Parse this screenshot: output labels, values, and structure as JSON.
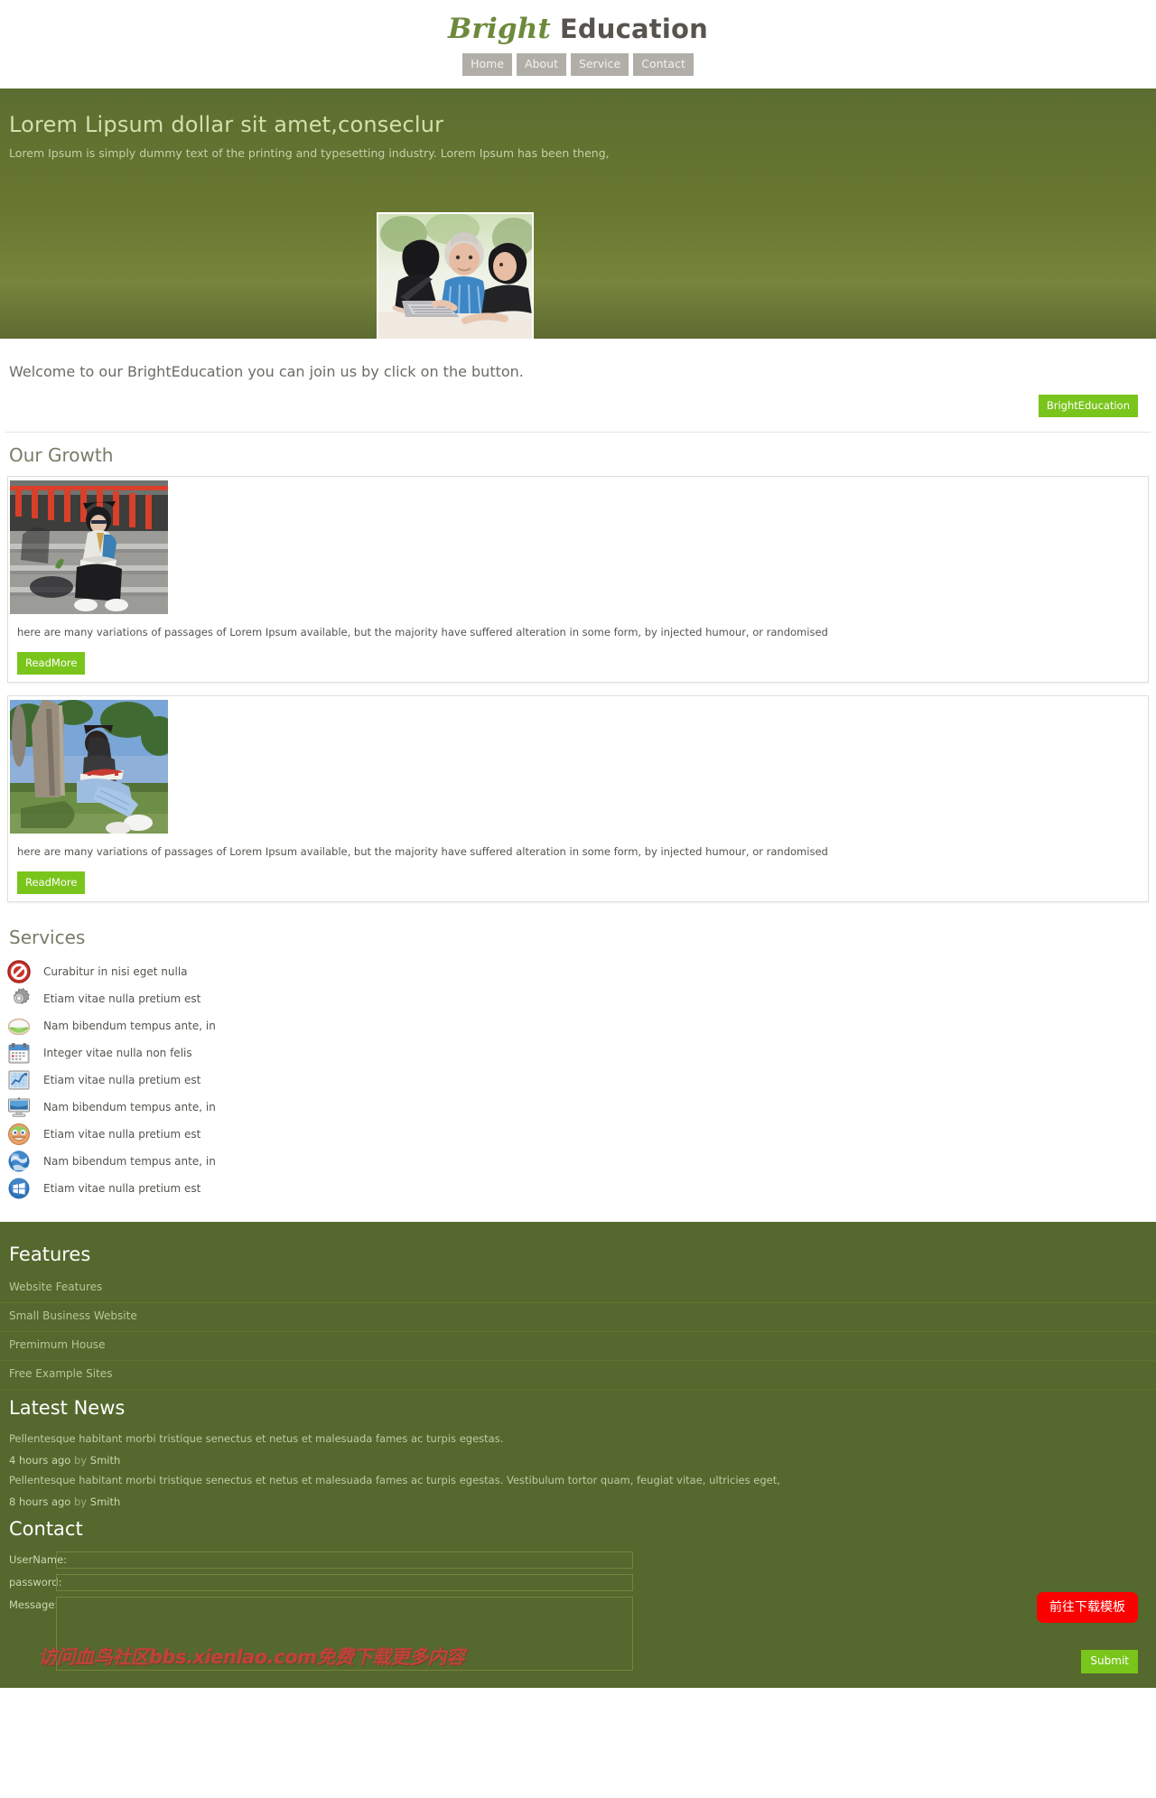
{
  "header": {
    "brand_script": "Bright",
    "brand_rest": "Education",
    "nav": [
      {
        "label": "Home"
      },
      {
        "label": "About"
      },
      {
        "label": "Service"
      },
      {
        "label": "Contact"
      }
    ]
  },
  "hero": {
    "title": "Lorem Lipsum dollar sit amet,conseclur",
    "subtitle": "Lorem Ipsum is simply dummy text of the printing and typesetting industry. Lorem Ipsum has been theng,",
    "photo_alt": "three-people-at-laptop-photo"
  },
  "welcome": {
    "text": "Welcome to our BrightEducation  you can join us by click on the button.",
    "button_label": "BrightEducation"
  },
  "growth": {
    "title": "Our Growth",
    "cards": [
      {
        "photo_alt": "person-reading-on-steps-photo",
        "text": "here are many variations of passages of Lorem Ipsum available, but the majority have suffered alteration in some form, by injected humour, or randomised",
        "button_label": "ReadMore"
      },
      {
        "photo_alt": "woman-reading-under-tree-photo",
        "text": "here are many variations of passages of Lorem Ipsum available, but the majority have suffered alteration in some form, by injected humour, or randomised",
        "button_label": "ReadMore"
      }
    ]
  },
  "services": {
    "title": "Services",
    "items": [
      {
        "icon": "no-entry-icon",
        "label": "Curabitur in nisi eget nulla"
      },
      {
        "icon": "gear-icon",
        "label": "Etiam vitae nulla pretium est"
      },
      {
        "icon": "green-dish-icon",
        "label": "Nam bibendum tempus ante, in"
      },
      {
        "icon": "calendar-icon",
        "label": "Integer vitae nulla non felis"
      },
      {
        "icon": "chart-window-icon",
        "label": "Etiam vitae nulla pretium est"
      },
      {
        "icon": "monitor-icon",
        "label": "Nam bibendum tempus ante, in"
      },
      {
        "icon": "smiley-face-icon",
        "label": "Etiam vitae nulla pretium est"
      },
      {
        "icon": "globe-icon",
        "label": "Nam bibendum tempus ante, in"
      },
      {
        "icon": "windows-logo-icon",
        "label": "Etiam vitae nulla pretium est"
      }
    ]
  },
  "footer": {
    "features": {
      "title": "Features",
      "items": [
        {
          "label": "Website  Features"
        },
        {
          "label": "Small  Business  Website"
        },
        {
          "label": "Premimum  House"
        },
        {
          "label": "Free  Example  Sites"
        }
      ]
    },
    "news": {
      "title": "Latest News",
      "entries": [
        {
          "text": "Pellentesque habitant morbi tristique senectus et netus et malesuada fames ac turpis egestas.",
          "time": "4 hours ago",
          "by": "by",
          "author": "Smith"
        },
        {
          "text": "Pellentesque habitant morbi tristique senectus et netus et malesuada fames ac turpis egestas. Vestibulum tortor quam, feugiat vitae, ultricies eget,",
          "time": "8 hours ago",
          "by": "by",
          "author": "Smith"
        }
      ]
    },
    "contact": {
      "title": "Contact",
      "username_label": "UserName:",
      "username_value": "",
      "password_label": "password:",
      "password_value": "",
      "message_label": "Message:",
      "message_value": "",
      "submit_label": "Submit"
    },
    "download_button_label": "前往下载模板",
    "watermark": "访问血鸟社区bbs.xienlao.com免费下载更多内容"
  },
  "colors": {
    "accent_green": "#7ac51c",
    "hero_green": "#67772f",
    "footer_green": "#55682d",
    "brand_script_green": "#6d8a3c",
    "download_red": "#fb0000",
    "watermark_red": "#c2403c"
  }
}
